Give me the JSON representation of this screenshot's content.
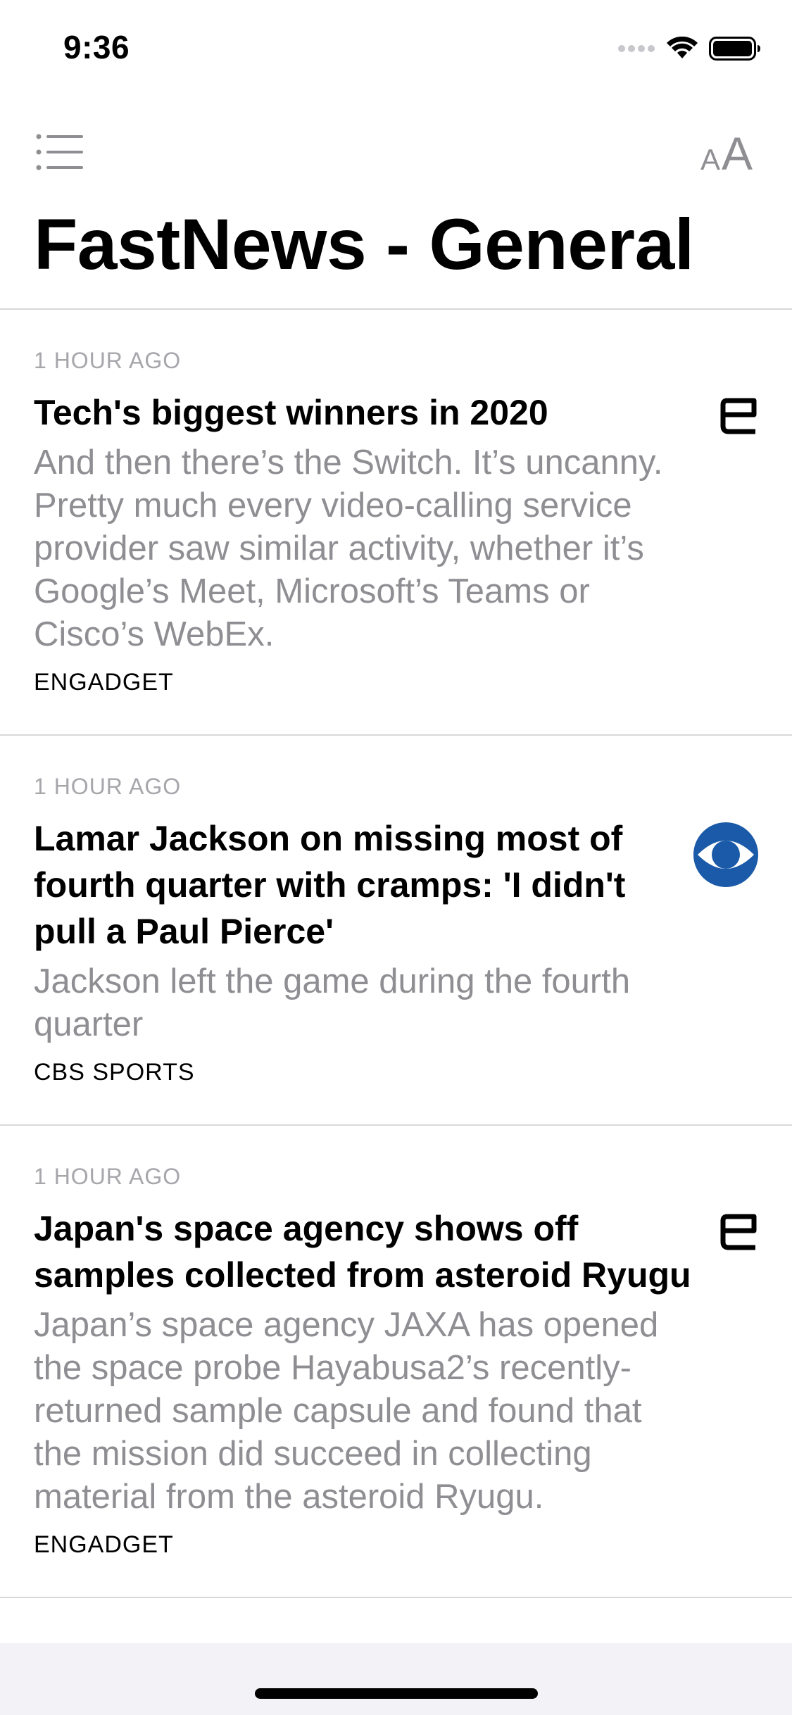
{
  "status_bar": {
    "time": "9:36",
    "icons": [
      "signal-icon",
      "wifi-icon",
      "battery-icon"
    ]
  },
  "nav": {
    "menu_icon": "list-icon",
    "text_size_icon": "text-size-icon",
    "text_size_small": "A",
    "text_size_large": "A"
  },
  "page": {
    "title": "FastNews - General"
  },
  "articles": [
    {
      "time": "1 HOUR AGO",
      "title": "Tech's biggest winners in 2020",
      "summary": "And then there’s the Switch. It’s uncanny. Pretty much every video-calling service provider saw similar activity, whether it’s Google’s Meet, Microsoft’s Teams or Cisco’s WebEx.",
      "source": "ENGADGET",
      "logo": "engadget-logo-icon"
    },
    {
      "time": "1 HOUR AGO",
      "title": "Lamar Jackson on missing most of fourth quarter with cramps: 'I didn't pull a Paul Pierce'",
      "summary": "Jackson left the game during the fourth quarter",
      "source": "CBS SPORTS",
      "logo": "cbs-eye-logo-icon"
    },
    {
      "time": "1 HOUR AGO",
      "title": "Japan's space agency shows off samples collected from asteroid Ryugu",
      "summary": "Japan’s space agency JAXA has opened the space probe Hayabusa2’s recently-returned sample capsule and found that the mission did succeed in collecting material from the asteroid Ryugu.",
      "source": "ENGADGET",
      "logo": "engadget-logo-icon"
    }
  ],
  "colors": {
    "secondary_text": "#8e8e93",
    "divider": "#d8d8dc",
    "cbs_blue": "#1a5aa8"
  }
}
